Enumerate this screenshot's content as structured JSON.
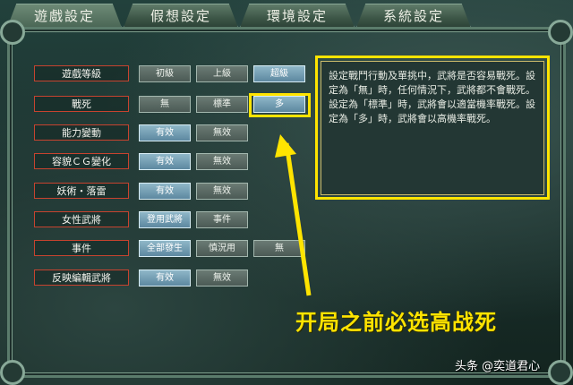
{
  "tabs": [
    {
      "label": "遊戲設定",
      "active": true
    },
    {
      "label": "假想設定",
      "active": false
    },
    {
      "label": "環境設定",
      "active": false
    },
    {
      "label": "系統設定",
      "active": false
    }
  ],
  "rows": [
    {
      "label": "遊戲等級",
      "options": [
        "初級",
        "上級",
        "超級"
      ],
      "selected": 2
    },
    {
      "label": "戰死",
      "options": [
        "無",
        "標準",
        "多"
      ],
      "selected": 2
    },
    {
      "label": "能力變動",
      "options": [
        "有效",
        "無效"
      ],
      "selected": 0
    },
    {
      "label": "容貌ＣＧ變化",
      "options": [
        "有效",
        "無效"
      ],
      "selected": 0
    },
    {
      "label": "妖術・落雷",
      "options": [
        "有效",
        "無效"
      ],
      "selected": 0
    },
    {
      "label": "女性武將",
      "options": [
        "登用武將",
        "事件"
      ],
      "selected": 0
    },
    {
      "label": "事件",
      "options": [
        "全部發生",
        "慎況用",
        "無"
      ],
      "selected": 0
    },
    {
      "label": "反映編輯武將",
      "options": [
        "有效",
        "無效"
      ],
      "selected": 0
    }
  ],
  "description": "設定戰鬥行動及單挑中，武將是否容易戰死。設定為「無」時，任何情況下，武將都不會戰死。設定為「標準」時，武將會以適當機率戰死。設定為「多」時，武將會以高機率戰死。",
  "caption": "开局之前必选高战死",
  "watermark": "头条 @奕道君心",
  "highlight_color": "#ffe400"
}
